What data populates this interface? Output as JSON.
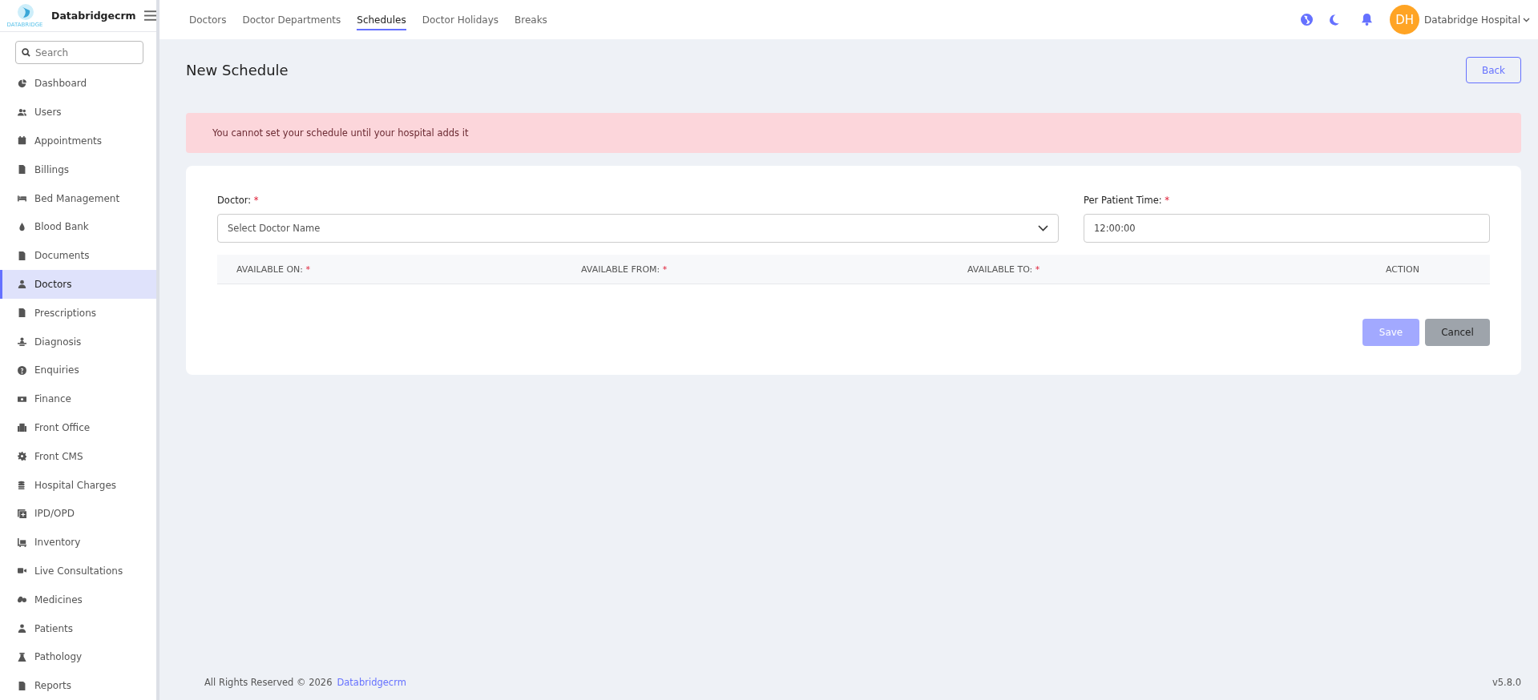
{
  "brand": {
    "name": "Databridgecrm",
    "logo_caption": "DATABRIDGE"
  },
  "search": {
    "placeholder": "Search"
  },
  "sidebar": {
    "items": [
      {
        "label": "Dashboard",
        "selected": false
      },
      {
        "label": "Users",
        "selected": false
      },
      {
        "label": "Appointments",
        "selected": false
      },
      {
        "label": "Billings",
        "selected": false
      },
      {
        "label": "Bed Management",
        "selected": false
      },
      {
        "label": "Blood Bank",
        "selected": false
      },
      {
        "label": "Documents",
        "selected": false
      },
      {
        "label": "Doctors",
        "selected": true
      },
      {
        "label": "Prescriptions",
        "selected": false
      },
      {
        "label": "Diagnosis",
        "selected": false
      },
      {
        "label": "Enquiries",
        "selected": false
      },
      {
        "label": "Finance",
        "selected": false
      },
      {
        "label": "Front Office",
        "selected": false
      },
      {
        "label": "Front CMS",
        "selected": false
      },
      {
        "label": "Hospital Charges",
        "selected": false
      },
      {
        "label": "IPD/OPD",
        "selected": false
      },
      {
        "label": "Inventory",
        "selected": false
      },
      {
        "label": "Live Consultations",
        "selected": false
      },
      {
        "label": "Medicines",
        "selected": false
      },
      {
        "label": "Patients",
        "selected": false
      },
      {
        "label": "Pathology",
        "selected": false
      },
      {
        "label": "Reports",
        "selected": false
      }
    ]
  },
  "tabs": [
    {
      "label": "Doctors",
      "selected": false
    },
    {
      "label": "Doctor Departments",
      "selected": false
    },
    {
      "label": "Schedules",
      "selected": true
    },
    {
      "label": "Doctor Holidays",
      "selected": false
    },
    {
      "label": "Breaks",
      "selected": false
    }
  ],
  "user": {
    "initials": "DH",
    "name": "Databridge Hospital"
  },
  "page": {
    "title": "New Schedule",
    "back_button": "Back"
  },
  "alert": {
    "message": "You cannot set your schedule until your hospital adds it"
  },
  "form": {
    "doctor": {
      "label": "Doctor:",
      "required_mark": "*",
      "placeholder": "Select Doctor Name"
    },
    "per_patient_time": {
      "label": "Per Patient Time:",
      "required_mark": "*",
      "value": "12:00:00"
    },
    "table": {
      "columns": [
        {
          "label": "AVAILABLE ON:",
          "required_mark": "*"
        },
        {
          "label": "AVAILABLE FROM:",
          "required_mark": "*"
        },
        {
          "label": "AVAILABLE TO:",
          "required_mark": "*"
        },
        {
          "label": "ACTION"
        }
      ]
    },
    "buttons": [
      {
        "label": "Save",
        "kind": "primary",
        "disabled": true
      },
      {
        "label": "Cancel",
        "kind": "secondary",
        "disabled": false
      }
    ]
  },
  "footer": {
    "copyright": "All Rights Reserved © 2026",
    "link": "Databridgecrm",
    "version": "v5.8.0"
  }
}
